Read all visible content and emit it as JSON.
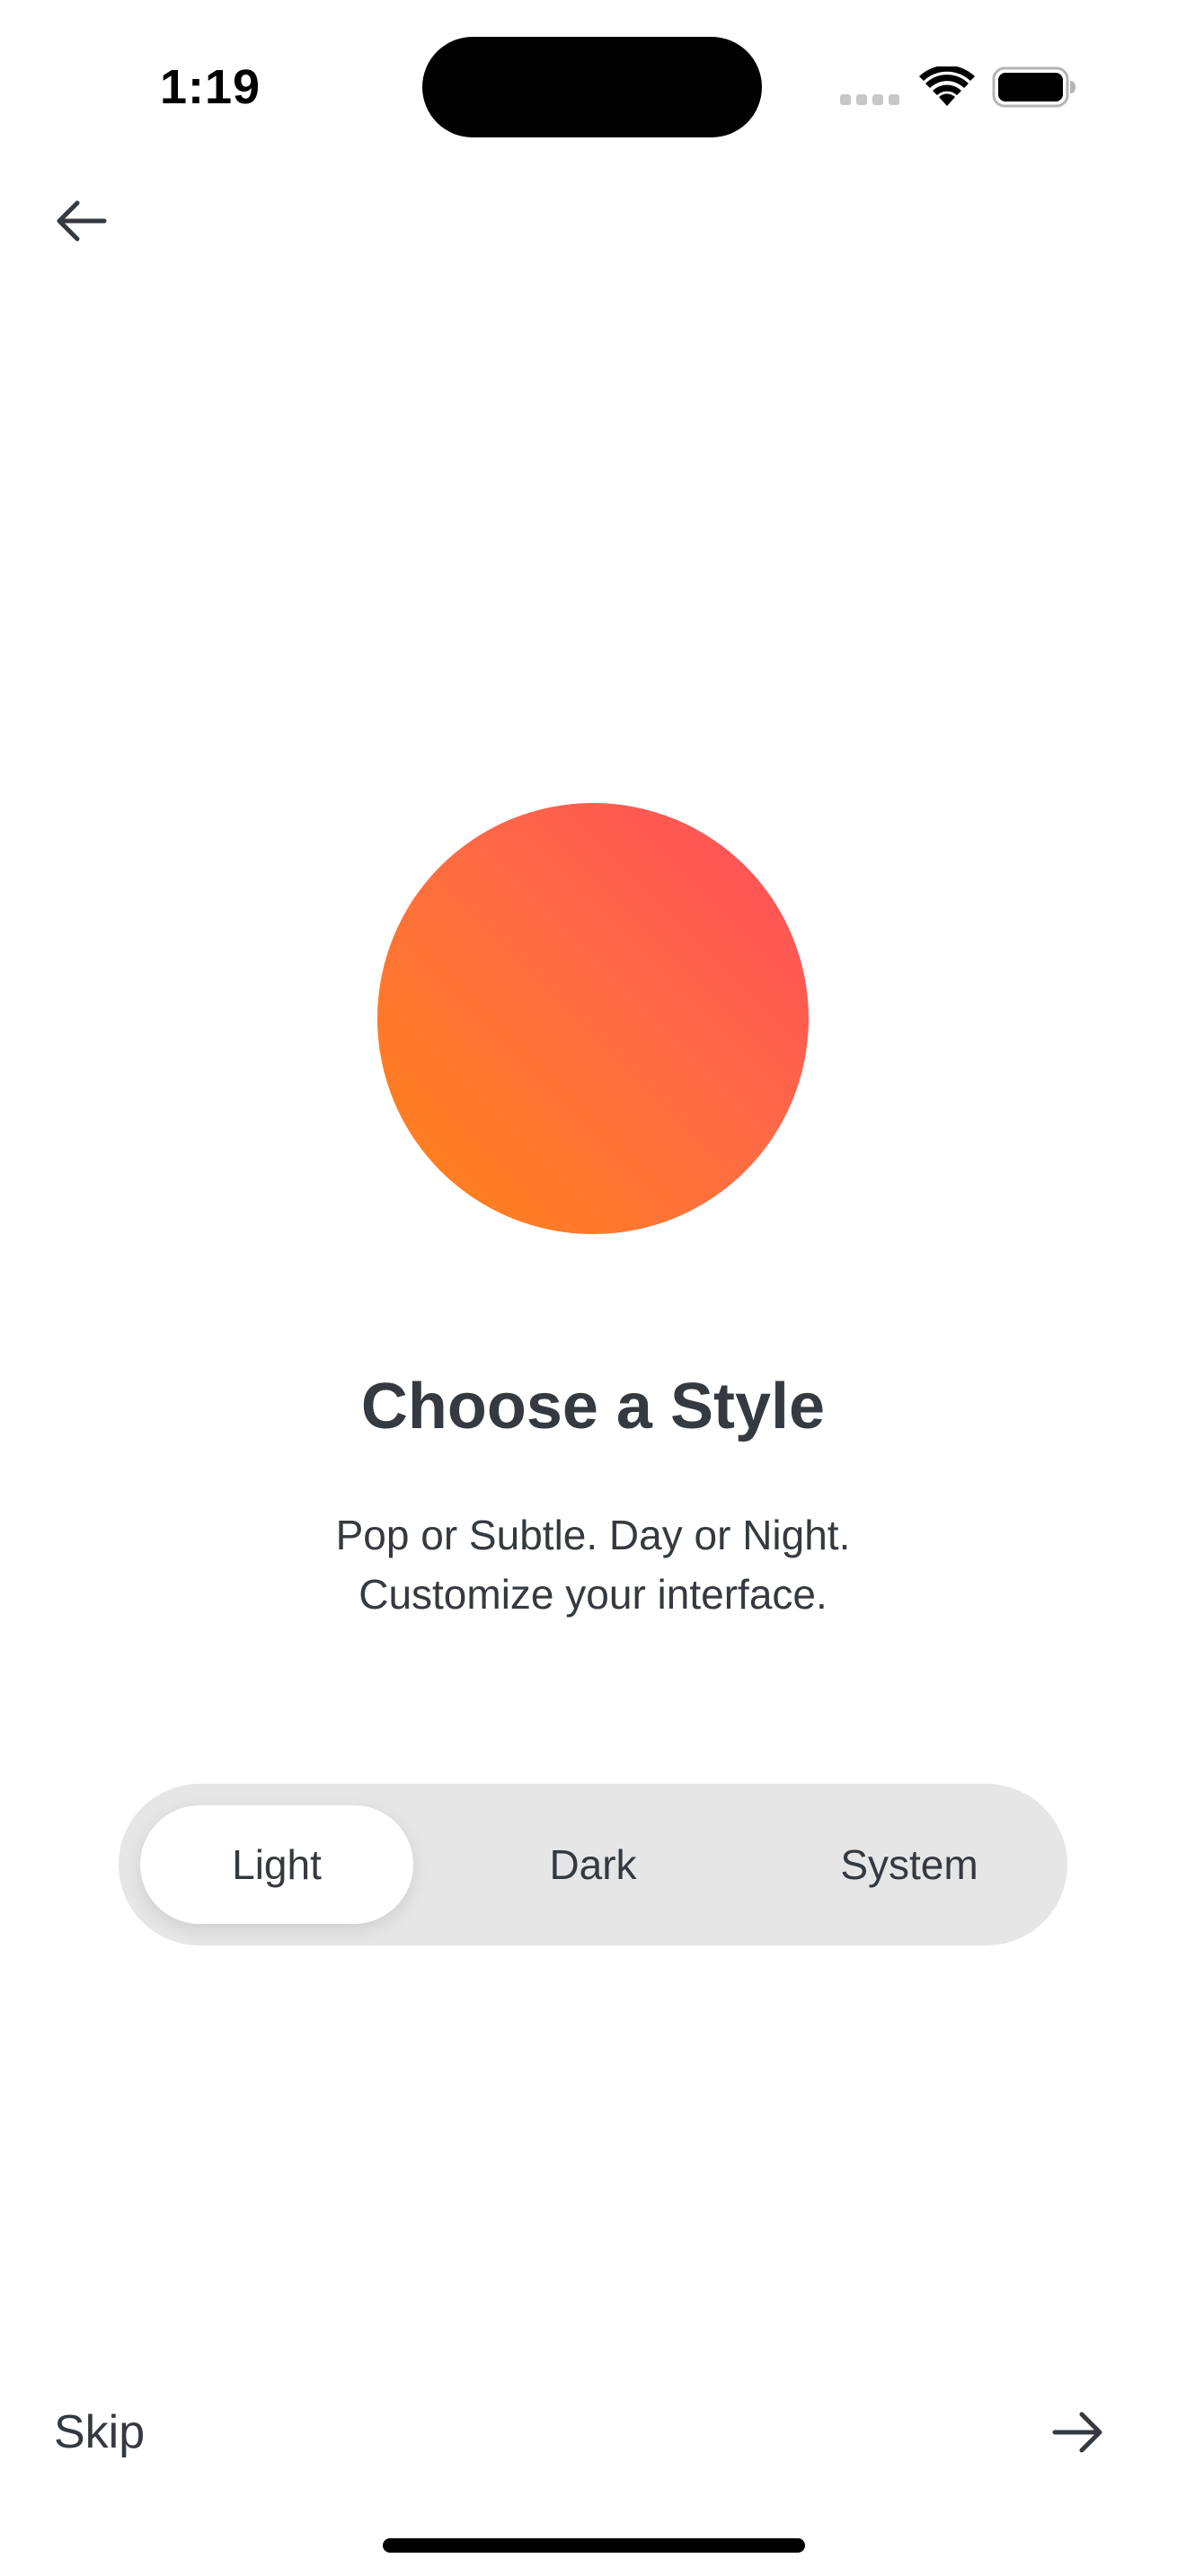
{
  "status_bar": {
    "time": "1:19"
  },
  "navigation": {
    "back_icon": "arrow-left-icon"
  },
  "hero": {
    "gradient_colors": [
      "#ff4c5d",
      "#ff6a45",
      "#ff8514"
    ]
  },
  "content": {
    "title": "Choose a Style",
    "subtitle_lines": [
      "Pop or Subtle. Day or Night.",
      "Customize your interface."
    ]
  },
  "appearance_picker": {
    "options": [
      {
        "label": "Light",
        "selected": true
      },
      {
        "label": "Dark",
        "selected": false
      },
      {
        "label": "System",
        "selected": false
      }
    ]
  },
  "footer": {
    "skip_label": "Skip",
    "next_icon": "arrow-right-icon"
  },
  "colors": {
    "text": "#353a40",
    "control_track": "#e6e6e6",
    "selected_segment": "#ffffff"
  }
}
